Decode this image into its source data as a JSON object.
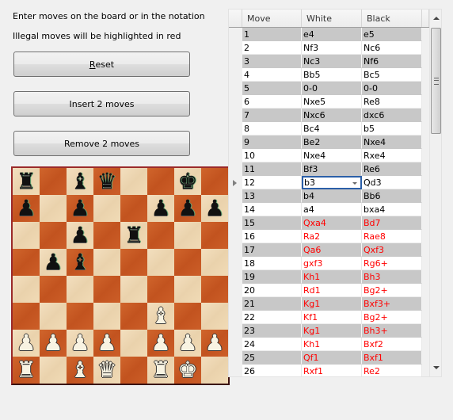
{
  "labels": {
    "instructions": "Enter moves on the board or in the notation",
    "illegal_note": "Illegal moves will be highlighted in red"
  },
  "buttons": {
    "reset": {
      "mnemonic": "R",
      "rest": "eset"
    },
    "insert": "Insert 2 moves",
    "remove": "Remove 2 moves"
  },
  "colors": {
    "illegal_move": "#ff0000",
    "editor_border": "#2b5fa8",
    "board_light": "#f1dbb6",
    "board_dark": "#c9592a"
  },
  "board": {
    "orientation": "white-bottom",
    "ranks": [
      [
        "bR",
        "",
        "bB",
        "bQ",
        "",
        "",
        "bK",
        ""
      ],
      [
        "bP",
        "",
        "bP",
        "",
        "",
        "bP",
        "bP",
        "bP"
      ],
      [
        "",
        "",
        "bP",
        "",
        "bR",
        "",
        "",
        ""
      ],
      [
        "",
        "bP",
        "bB",
        "",
        "",
        "",
        "",
        ""
      ],
      [
        "",
        "",
        "",
        "",
        "",
        "",
        "",
        ""
      ],
      [
        "",
        "",
        "",
        "",
        "",
        "wB",
        "",
        ""
      ],
      [
        "wP",
        "wP",
        "wP",
        "wP",
        "",
        "wP",
        "wP",
        "wP"
      ],
      [
        "wR",
        "",
        "wB",
        "wQ",
        "",
        "wR",
        "wK",
        ""
      ]
    ]
  },
  "grid": {
    "columns": [
      "Move",
      "White",
      "Black"
    ],
    "current_row": 12,
    "editing_cell": {
      "row": 12,
      "column": "White",
      "value": "b3"
    },
    "rows": [
      {
        "move": "1",
        "white": "e4",
        "black": "e5",
        "white_illegal": false,
        "black_illegal": false
      },
      {
        "move": "2",
        "white": "Nf3",
        "black": "Nc6",
        "white_illegal": false,
        "black_illegal": false
      },
      {
        "move": "3",
        "white": "Nc3",
        "black": "Nf6",
        "white_illegal": false,
        "black_illegal": false
      },
      {
        "move": "4",
        "white": "Bb5",
        "black": "Bc5",
        "white_illegal": false,
        "black_illegal": false
      },
      {
        "move": "5",
        "white": "0-0",
        "black": "0-0",
        "white_illegal": false,
        "black_illegal": false
      },
      {
        "move": "6",
        "white": "Nxe5",
        "black": "Re8",
        "white_illegal": false,
        "black_illegal": false
      },
      {
        "move": "7",
        "white": "Nxc6",
        "black": "dxc6",
        "white_illegal": false,
        "black_illegal": false
      },
      {
        "move": "8",
        "white": "Bc4",
        "black": "b5",
        "white_illegal": false,
        "black_illegal": false
      },
      {
        "move": "9",
        "white": "Be2",
        "black": "Nxe4",
        "white_illegal": false,
        "black_illegal": false
      },
      {
        "move": "10",
        "white": "Nxe4",
        "black": "Rxe4",
        "white_illegal": false,
        "black_illegal": false
      },
      {
        "move": "11",
        "white": "Bf3",
        "black": "Re6",
        "white_illegal": false,
        "black_illegal": false
      },
      {
        "move": "12",
        "white": "b3",
        "black": "Qd3",
        "white_illegal": false,
        "black_illegal": false
      },
      {
        "move": "13",
        "white": "b4",
        "black": "Bb6",
        "white_illegal": false,
        "black_illegal": false
      },
      {
        "move": "14",
        "white": "a4",
        "black": "bxa4",
        "white_illegal": false,
        "black_illegal": false
      },
      {
        "move": "15",
        "white": "Qxa4",
        "black": "Bd7",
        "white_illegal": true,
        "black_illegal": true
      },
      {
        "move": "16",
        "white": "Ra2",
        "black": "Rae8",
        "white_illegal": true,
        "black_illegal": true
      },
      {
        "move": "17",
        "white": "Qa6",
        "black": "Qxf3",
        "white_illegal": true,
        "black_illegal": true
      },
      {
        "move": "18",
        "white": "gxf3",
        "black": "Rg6+",
        "white_illegal": true,
        "black_illegal": true
      },
      {
        "move": "19",
        "white": "Kh1",
        "black": "Bh3",
        "white_illegal": true,
        "black_illegal": true
      },
      {
        "move": "20",
        "white": "Rd1",
        "black": "Bg2+",
        "white_illegal": true,
        "black_illegal": true
      },
      {
        "move": "21",
        "white": "Kg1",
        "black": "Bxf3+",
        "white_illegal": true,
        "black_illegal": true
      },
      {
        "move": "22",
        "white": "Kf1",
        "black": "Bg2+",
        "white_illegal": true,
        "black_illegal": true
      },
      {
        "move": "23",
        "white": "Kg1",
        "black": "Bh3+",
        "white_illegal": true,
        "black_illegal": true
      },
      {
        "move": "24",
        "white": "Kh1",
        "black": "Bxf2",
        "white_illegal": true,
        "black_illegal": true
      },
      {
        "move": "25",
        "white": "Qf1",
        "black": "Bxf1",
        "white_illegal": true,
        "black_illegal": true
      },
      {
        "move": "26",
        "white": "Rxf1",
        "black": "Re2",
        "white_illegal": true,
        "black_illegal": true
      }
    ]
  },
  "scrollbar": {
    "position_fraction": 0.0,
    "visible_fraction": 0.3
  }
}
